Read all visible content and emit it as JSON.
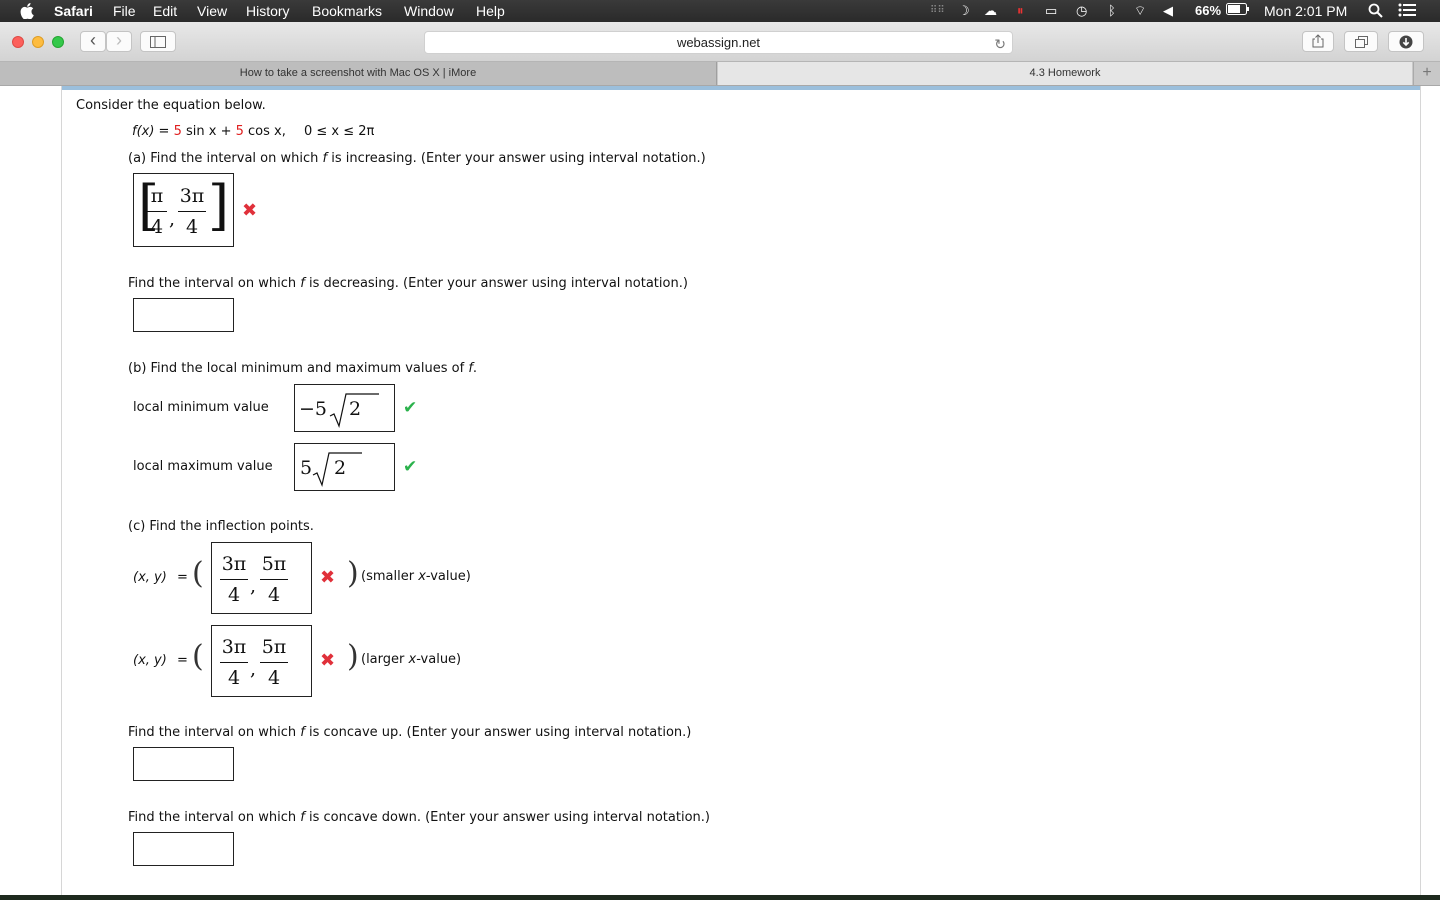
{
  "menubar": {
    "apple": "",
    "app": "Safari",
    "items": [
      "File",
      "Edit",
      "View",
      "History",
      "Bookmarks",
      "Window",
      "Help"
    ],
    "battery": "66%",
    "clock": "Mon 2:01 PM"
  },
  "toolbar": {
    "back": "‹",
    "forward": "›",
    "url": "webassign.net"
  },
  "tabs": [
    {
      "label": "How to take a screenshot with Mac OS X | iMore"
    },
    {
      "label": "4.3 Homework"
    }
  ],
  "newtab": "+",
  "problem": {
    "intro": "Consider the equation below.",
    "equation": {
      "lhs": "f(x) = ",
      "c1": "5",
      "t1": " sin x + ",
      "c2": "5",
      "t2": " cos x,",
      "domain": "0 ≤ x ≤ 2π"
    },
    "part_a": {
      "prompt_pre": "(a) Find the interval on which ",
      "prompt_f": "f",
      "prompt_post": " is increasing. (Enter your answer using interval notation.)",
      "answer": {
        "open": "[",
        "n1": "π",
        "d1": "4",
        "sep": ",",
        "n2": "3π",
        "d2": "4",
        "close": "]"
      },
      "status": "incorrect"
    },
    "decreasing": {
      "prompt_pre": "Find the interval on which ",
      "prompt_f": "f",
      "prompt_post": " is decreasing. (Enter your answer using interval notation.)",
      "answer": ""
    },
    "part_b": {
      "prompt_pre": "(b) Find the local minimum and maximum values of ",
      "prompt_f": "f",
      "prompt_post": ".",
      "min_label": "local minimum value",
      "min_coef": "−5",
      "min_rad": "2",
      "max_label": "local maximum value",
      "max_coef": "5",
      "max_rad": "2",
      "status": "correct"
    },
    "part_c": {
      "prompt": "(c) Find the inflection points.",
      "xy": "(x, y)",
      "eq": "=",
      "p1": {
        "n1": "3π",
        "d1": "4",
        "sep": ",",
        "n2": "5π",
        "d2": "4",
        "note_pre": "(smaller ",
        "note_x": "x",
        "note_post": "-value)"
      },
      "p2": {
        "n1": "3π",
        "d1": "4",
        "sep": ",",
        "n2": "5π",
        "d2": "4",
        "note_pre": "(larger ",
        "note_x": "x",
        "note_post": "-value)"
      },
      "status": "incorrect"
    },
    "concave_up": {
      "prompt_pre": "Find the interval on which ",
      "prompt_f": "f",
      "prompt_post": " is concave up. (Enter your answer using interval notation.)",
      "answer": ""
    },
    "concave_down": {
      "prompt_pre": "Find the interval on which ",
      "prompt_f": "f",
      "prompt_post": " is concave down. (Enter your answer using interval notation.)",
      "answer": ""
    }
  },
  "marks": {
    "wrong": "✖",
    "right": "✔"
  }
}
